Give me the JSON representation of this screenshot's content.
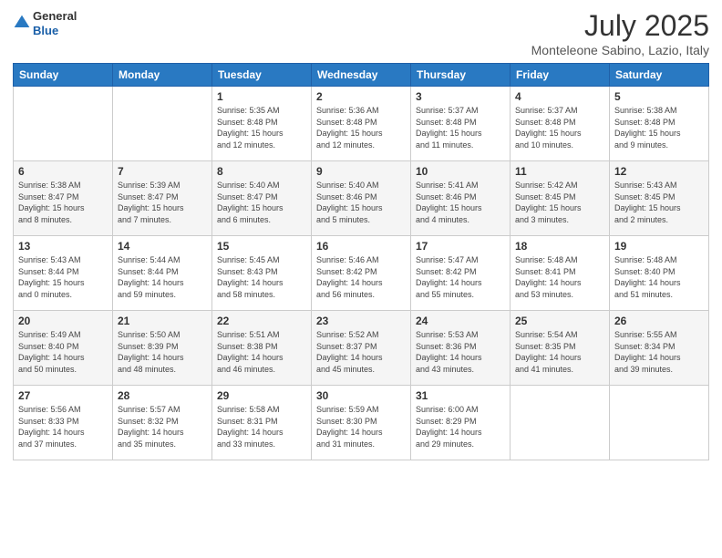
{
  "header": {
    "logo_line1": "General",
    "logo_line2": "Blue",
    "month": "July 2025",
    "location": "Monteleone Sabino, Lazio, Italy"
  },
  "weekdays": [
    "Sunday",
    "Monday",
    "Tuesday",
    "Wednesday",
    "Thursday",
    "Friday",
    "Saturday"
  ],
  "weeks": [
    [
      {
        "day": "",
        "info": ""
      },
      {
        "day": "",
        "info": ""
      },
      {
        "day": "1",
        "info": "Sunrise: 5:35 AM\nSunset: 8:48 PM\nDaylight: 15 hours\nand 12 minutes."
      },
      {
        "day": "2",
        "info": "Sunrise: 5:36 AM\nSunset: 8:48 PM\nDaylight: 15 hours\nand 12 minutes."
      },
      {
        "day": "3",
        "info": "Sunrise: 5:37 AM\nSunset: 8:48 PM\nDaylight: 15 hours\nand 11 minutes."
      },
      {
        "day": "4",
        "info": "Sunrise: 5:37 AM\nSunset: 8:48 PM\nDaylight: 15 hours\nand 10 minutes."
      },
      {
        "day": "5",
        "info": "Sunrise: 5:38 AM\nSunset: 8:48 PM\nDaylight: 15 hours\nand 9 minutes."
      }
    ],
    [
      {
        "day": "6",
        "info": "Sunrise: 5:38 AM\nSunset: 8:47 PM\nDaylight: 15 hours\nand 8 minutes."
      },
      {
        "day": "7",
        "info": "Sunrise: 5:39 AM\nSunset: 8:47 PM\nDaylight: 15 hours\nand 7 minutes."
      },
      {
        "day": "8",
        "info": "Sunrise: 5:40 AM\nSunset: 8:47 PM\nDaylight: 15 hours\nand 6 minutes."
      },
      {
        "day": "9",
        "info": "Sunrise: 5:40 AM\nSunset: 8:46 PM\nDaylight: 15 hours\nand 5 minutes."
      },
      {
        "day": "10",
        "info": "Sunrise: 5:41 AM\nSunset: 8:46 PM\nDaylight: 15 hours\nand 4 minutes."
      },
      {
        "day": "11",
        "info": "Sunrise: 5:42 AM\nSunset: 8:45 PM\nDaylight: 15 hours\nand 3 minutes."
      },
      {
        "day": "12",
        "info": "Sunrise: 5:43 AM\nSunset: 8:45 PM\nDaylight: 15 hours\nand 2 minutes."
      }
    ],
    [
      {
        "day": "13",
        "info": "Sunrise: 5:43 AM\nSunset: 8:44 PM\nDaylight: 15 hours\nand 0 minutes."
      },
      {
        "day": "14",
        "info": "Sunrise: 5:44 AM\nSunset: 8:44 PM\nDaylight: 14 hours\nand 59 minutes."
      },
      {
        "day": "15",
        "info": "Sunrise: 5:45 AM\nSunset: 8:43 PM\nDaylight: 14 hours\nand 58 minutes."
      },
      {
        "day": "16",
        "info": "Sunrise: 5:46 AM\nSunset: 8:42 PM\nDaylight: 14 hours\nand 56 minutes."
      },
      {
        "day": "17",
        "info": "Sunrise: 5:47 AM\nSunset: 8:42 PM\nDaylight: 14 hours\nand 55 minutes."
      },
      {
        "day": "18",
        "info": "Sunrise: 5:48 AM\nSunset: 8:41 PM\nDaylight: 14 hours\nand 53 minutes."
      },
      {
        "day": "19",
        "info": "Sunrise: 5:48 AM\nSunset: 8:40 PM\nDaylight: 14 hours\nand 51 minutes."
      }
    ],
    [
      {
        "day": "20",
        "info": "Sunrise: 5:49 AM\nSunset: 8:40 PM\nDaylight: 14 hours\nand 50 minutes."
      },
      {
        "day": "21",
        "info": "Sunrise: 5:50 AM\nSunset: 8:39 PM\nDaylight: 14 hours\nand 48 minutes."
      },
      {
        "day": "22",
        "info": "Sunrise: 5:51 AM\nSunset: 8:38 PM\nDaylight: 14 hours\nand 46 minutes."
      },
      {
        "day": "23",
        "info": "Sunrise: 5:52 AM\nSunset: 8:37 PM\nDaylight: 14 hours\nand 45 minutes."
      },
      {
        "day": "24",
        "info": "Sunrise: 5:53 AM\nSunset: 8:36 PM\nDaylight: 14 hours\nand 43 minutes."
      },
      {
        "day": "25",
        "info": "Sunrise: 5:54 AM\nSunset: 8:35 PM\nDaylight: 14 hours\nand 41 minutes."
      },
      {
        "day": "26",
        "info": "Sunrise: 5:55 AM\nSunset: 8:34 PM\nDaylight: 14 hours\nand 39 minutes."
      }
    ],
    [
      {
        "day": "27",
        "info": "Sunrise: 5:56 AM\nSunset: 8:33 PM\nDaylight: 14 hours\nand 37 minutes."
      },
      {
        "day": "28",
        "info": "Sunrise: 5:57 AM\nSunset: 8:32 PM\nDaylight: 14 hours\nand 35 minutes."
      },
      {
        "day": "29",
        "info": "Sunrise: 5:58 AM\nSunset: 8:31 PM\nDaylight: 14 hours\nand 33 minutes."
      },
      {
        "day": "30",
        "info": "Sunrise: 5:59 AM\nSunset: 8:30 PM\nDaylight: 14 hours\nand 31 minutes."
      },
      {
        "day": "31",
        "info": "Sunrise: 6:00 AM\nSunset: 8:29 PM\nDaylight: 14 hours\nand 29 minutes."
      },
      {
        "day": "",
        "info": ""
      },
      {
        "day": "",
        "info": ""
      }
    ]
  ]
}
